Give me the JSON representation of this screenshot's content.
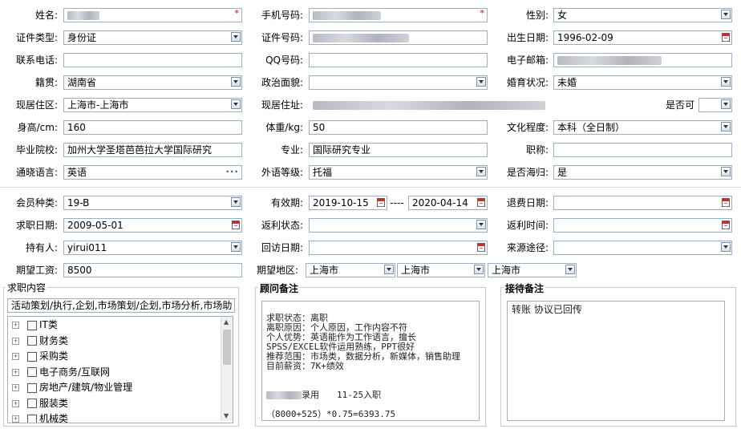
{
  "form": {
    "name_label": "姓名:",
    "mobile_label": "手机号码:",
    "gender_label": "性别:",
    "gender_value": "女",
    "id_type_label": "证件类型:",
    "id_type_value": "身份证",
    "id_number_label": "证件号码:",
    "birthdate_label": "出生日期:",
    "birthdate_value": "1996-02-09",
    "phone_label": "联系电话:",
    "qq_label": "QQ号码:",
    "email_label": "电子邮箱:",
    "native_label": "籍贯:",
    "native_value": "湖南省",
    "politics_label": "政治面貌:",
    "marital_label": "婚育状况:",
    "marital_value": "未婚",
    "residence_label": "现居住区:",
    "residence_value": "上海市-上海市",
    "address_label": "现居住址:",
    "whether_label": "是否可",
    "height_label": "身高/cm:",
    "height_value": "160",
    "weight_label": "体重/kg:",
    "weight_value": "50",
    "education_label": "文化程度:",
    "education_value": "本科（全日制）",
    "school_label": "毕业院校:",
    "school_value": "加州大学圣塔芭芭拉大学国际研究",
    "major_label": "专业:",
    "major_value": "国际研究专业",
    "title_label": "职称:",
    "language_label": "通晓语言:",
    "language_value": "英语",
    "lang_level_label": "外语等级:",
    "lang_level_value": "托福",
    "returnee_label": "是否海归:",
    "returnee_value": "是"
  },
  "member": {
    "type_label": "会员种类:",
    "type_value": "19-B",
    "valid_label": "有效期:",
    "valid_from": "2019-10-15",
    "valid_sep": "----",
    "valid_to": "2020-04-14",
    "refund_label": "退费日期:",
    "job_date_label": "求职日期:",
    "job_date_value": "2009-05-01",
    "rebate_status_label": "返利状态:",
    "rebate_time_label": "返利时间:",
    "holder_label": "持有人:",
    "holder_value": "yirui011",
    "revisit_label": "回访日期:",
    "source_label": "来源途径:",
    "salary_label": "期望工资:",
    "salary_value": "8500",
    "region_label": "期望地区:",
    "region_values": [
      "上海市",
      "上海市",
      "上海市"
    ]
  },
  "job_content": {
    "title": "求职内容",
    "summary": "活动策划/执行,企划,市场策划/企划,市场分析,市场助",
    "tree": [
      "IT类",
      "财务类",
      "采购类",
      "电子商务/互联网",
      "房地产/建筑/物业管理",
      "服装类",
      "机械类"
    ]
  },
  "advisor_notes": {
    "title": "顾问备注",
    "content": "求职状态：离职\n离职原因：个人原因，工作内容不符\n个人优势：英语能作为工作语言，擅长\nSPSS/EXCEL软件运用熟练，PPT很好\n推荐范围：市场类，数据分析，新媒体，销售助理\n目前薪资：7K+绩效",
    "line2_text": "录用　　11-25入职",
    "line3_text": "（8000+525）*0.75=6393.75"
  },
  "reception_notes": {
    "title": "接待备注",
    "content": "转账 协议已回传"
  }
}
